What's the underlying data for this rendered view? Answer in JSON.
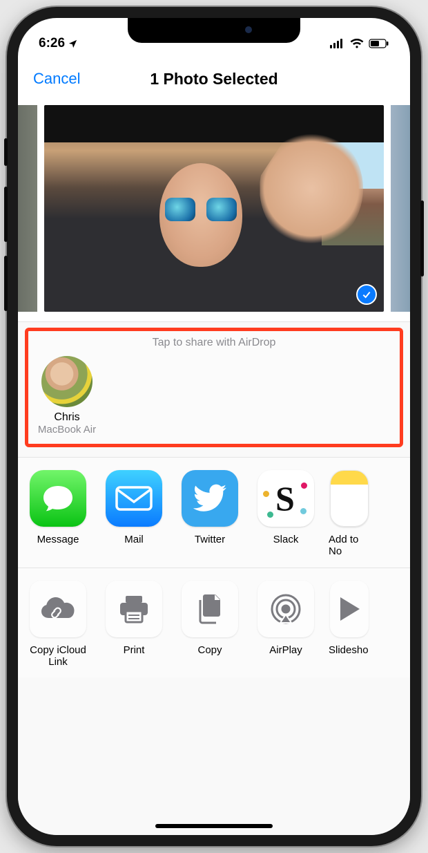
{
  "status": {
    "time": "6:26"
  },
  "nav": {
    "cancel": "Cancel",
    "title": "1 Photo Selected"
  },
  "airdrop": {
    "prompt": "Tap to share with AirDrop",
    "targets": [
      {
        "name": "Chris",
        "device": "MacBook Air"
      }
    ]
  },
  "apps": [
    {
      "id": "message",
      "label": "Message"
    },
    {
      "id": "mail",
      "label": "Mail"
    },
    {
      "id": "twitter",
      "label": "Twitter"
    },
    {
      "id": "slack",
      "label": "Slack"
    },
    {
      "id": "notes",
      "label": "Add to No"
    }
  ],
  "actions": [
    {
      "id": "icloud",
      "label": "Copy iCloud Link"
    },
    {
      "id": "print",
      "label": "Print"
    },
    {
      "id": "copy",
      "label": "Copy"
    },
    {
      "id": "airplay",
      "label": "AirPlay"
    },
    {
      "id": "slideshow",
      "label": "Slidesho"
    }
  ]
}
